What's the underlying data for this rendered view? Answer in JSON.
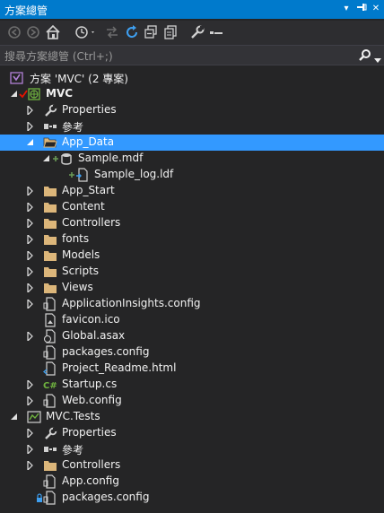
{
  "titlebar": {
    "title": "方案總管",
    "dropdown_glyph": "▾",
    "pin_glyph": "⊣",
    "close_glyph": "✕"
  },
  "toolbar": {
    "buttons": [
      "back-icon",
      "forward-icon",
      "home-icon",
      "history-icon",
      "sync-icon",
      "refresh-icon",
      "collapse-all-icon",
      "show-all-files-icon",
      "properties-wrench-icon",
      "preview-icon"
    ]
  },
  "search": {
    "placeholder": "搜尋方案總管 (Ctrl+;)"
  },
  "solution": {
    "label": "方案 'MVC' (2 專案)"
  },
  "tree": {
    "mvc": "MVC",
    "properties": "Properties",
    "references": "參考",
    "app_data": "App_Data",
    "sample_mdf": "Sample.mdf",
    "sample_log": "Sample_log.ldf",
    "app_start": "App_Start",
    "content": "Content",
    "controllers": "Controllers",
    "fonts": "fonts",
    "models": "Models",
    "scripts": "Scripts",
    "views": "Views",
    "appinsights": "ApplicationInsights.config",
    "favicon": "favicon.ico",
    "global": "Global.asax",
    "packages": "packages.config",
    "readme": "Project_Readme.html",
    "startup": "Startup.cs",
    "webconfig": "Web.config",
    "tests": "MVC.Tests",
    "t_properties": "Properties",
    "t_references": "參考",
    "t_controllers": "Controllers",
    "t_appconfig": "App.config",
    "t_packages": "packages.config"
  },
  "colors": {
    "background": "#252526",
    "selection": "#3399ff",
    "titlebar": "#007acc",
    "folder": "#dcb67a",
    "add_marker": "#6a9955",
    "checkout_marker": "#e51400"
  }
}
